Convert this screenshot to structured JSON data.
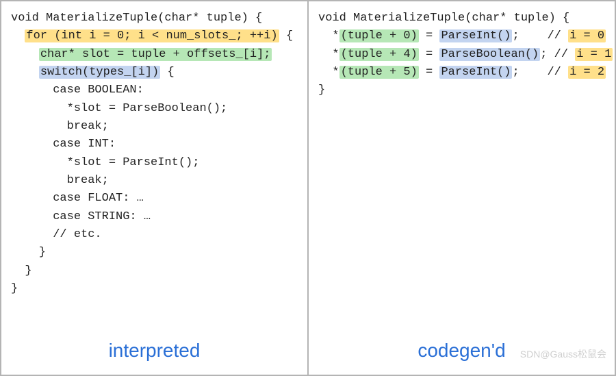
{
  "left": {
    "caption": "interpreted",
    "code": {
      "l1": "void MaterializeTuple(char* tuple) {",
      "l2_hl": "for (int i = 0; i < num_slots_; ++i)",
      "l2_tail": " {",
      "l3_hl": "char* slot = tuple + offsets_[i];",
      "l4_hl": "switch(types_[i])",
      "l4_tail": " {",
      "l5": "      case BOOLEAN:",
      "l6": "        *slot = ParseBoolean();",
      "l7": "        break;",
      "l8": "      case INT:",
      "l9": "        *slot = ParseInt();",
      "l10": "        break;",
      "l11": "      case FLOAT: …",
      "l12": "      case STRING: …",
      "l13": "      // etc.",
      "l14": "    }",
      "l15": "  }",
      "l16": "}"
    }
  },
  "right": {
    "caption": "codegen'd",
    "code": {
      "l1": "void MaterializeTuple(char* tuple) {",
      "r1_pre": "  *",
      "r1_g": "(tuple + 0)",
      "r1_mid": " = ",
      "r1_b": "ParseInt()",
      "r1_post": ";    // ",
      "r1_y": "i = 0",
      "r2_pre": "  *",
      "r2_g": "(tuple + 4)",
      "r2_mid": " = ",
      "r2_b": "ParseBoolean()",
      "r2_post": "; // ",
      "r2_y": "i = 1",
      "r3_pre": "  *",
      "r3_g": "(tuple + 5)",
      "r3_mid": " = ",
      "r3_b": "ParseInt()",
      "r3_post": ";    // ",
      "r3_y": "i = 2",
      "l5": "}"
    }
  },
  "watermark": "SDN@Gauss松鼠会"
}
